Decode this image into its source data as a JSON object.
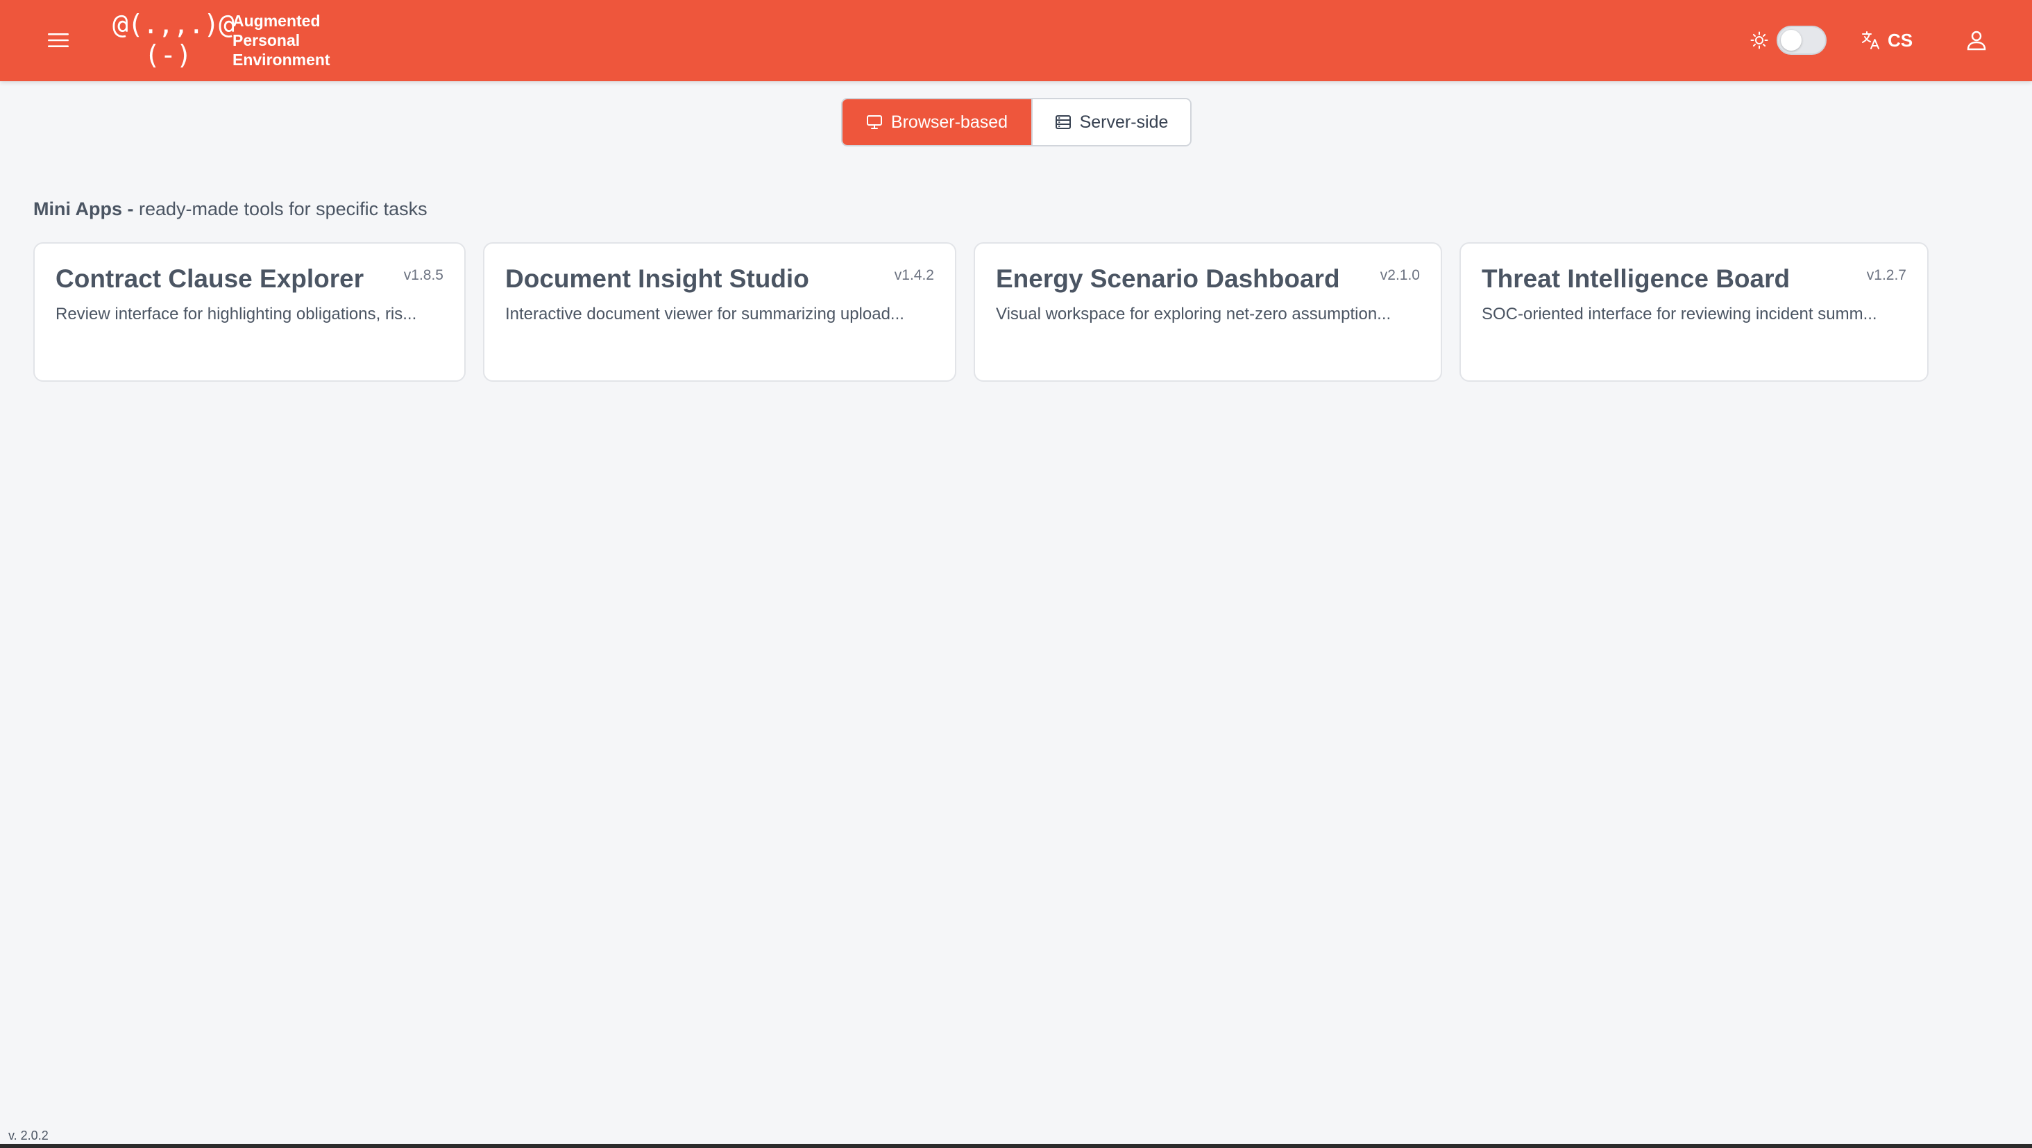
{
  "header": {
    "logo_line1": "@(.,,.)@",
    "logo_line2": "(-)",
    "brand_lines": [
      "Augmented",
      "Personal",
      "Environment"
    ],
    "language_label": "CS",
    "theme_dark_enabled": false
  },
  "segment": {
    "browser_label": "Browser-based",
    "server_label": "Server-side",
    "selected": "Browser-based"
  },
  "section": {
    "title_strong": "Mini Apps -",
    "title_rest": " ready-made tools for specific tasks"
  },
  "apps": [
    {
      "title": "Contract Clause Explorer",
      "version": "v1.8.5",
      "description": "Review interface for highlighting obligations, ris..."
    },
    {
      "title": "Document Insight Studio",
      "version": "v1.4.2",
      "description": "Interactive document viewer for summarizing upload..."
    },
    {
      "title": "Energy Scenario Dashboard",
      "version": "v2.1.0",
      "description": "Visual workspace for exploring net-zero assumption..."
    },
    {
      "title": "Threat Intelligence Board",
      "version": "v1.2.7",
      "description": "SOC-oriented interface for reviewing incident summ..."
    }
  ],
  "footer": {
    "version": "v. 2.0.2"
  },
  "colors": {
    "brand": "#ee563c",
    "background": "#f5f6f8",
    "text": "#4b5563"
  }
}
